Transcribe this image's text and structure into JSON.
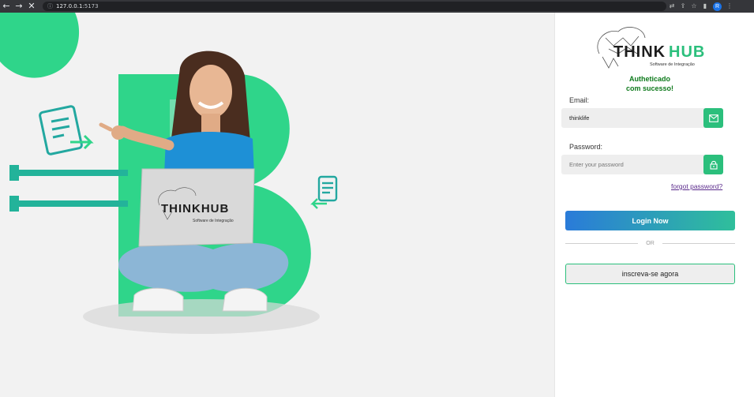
{
  "browser": {
    "back_icon": "←",
    "forward_icon": "→",
    "stop_icon": "✕",
    "address_info_icon": "ⓘ",
    "url_host": "127.0.0.1",
    "url_port": ":5173",
    "extension_icons": [
      "translate-icon",
      "share-icon",
      "bookmark-star-icon",
      "sidebar-icon"
    ],
    "profile_initial": "R",
    "menu_icon": "⋮"
  },
  "hero": {
    "brand_letter": "B",
    "laptop_logo_text": "THINKHUB",
    "laptop_logo_subtitle": "Software de Integração",
    "colors": {
      "green": "#2fd58a",
      "teal": "#23b39a",
      "background": "#f2f2f2"
    }
  },
  "logo": {
    "text": "THINKHUB",
    "subtitle": "Software de Integração",
    "colors": {
      "dark": "#1d1d1d",
      "green": "#2bbf7c"
    }
  },
  "status": {
    "line1": "Autheticado",
    "line2": "com sucesso!",
    "color": "#0e7a1c"
  },
  "form": {
    "email_label": "Email:",
    "email_value": "thinklife",
    "password_label": "Password:",
    "password_placeholder": "Enter your password",
    "forgot_label": "forgot password?",
    "login_label": "Login Now",
    "or_label": "OR",
    "signup_label": "inscreva-se agora",
    "accent_color": "#2bbf7c"
  }
}
